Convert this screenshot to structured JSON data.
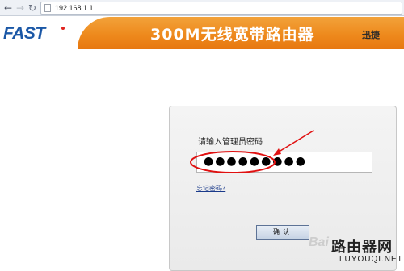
{
  "browser": {
    "url": "192.168.1.1",
    "back_glyph": "←",
    "forward_glyph": "→",
    "reload_glyph": "↻"
  },
  "header": {
    "logo": "FAST",
    "title": "300M无线宽带路由器",
    "brand": "迅捷"
  },
  "login": {
    "prompt": "请输入管理员密码",
    "password_masked": "●●●●●●●●●",
    "forgot_link": "忘记密码?",
    "confirm_label": "确认"
  },
  "watermark": {
    "baidu": "Bai",
    "site_cn": "路由器网",
    "site_en": "LUYOUQI.NET"
  },
  "colors": {
    "brand_blue": "#1a57a6",
    "header_orange": "#ee8a1d",
    "annotation_red": "#e01010"
  }
}
